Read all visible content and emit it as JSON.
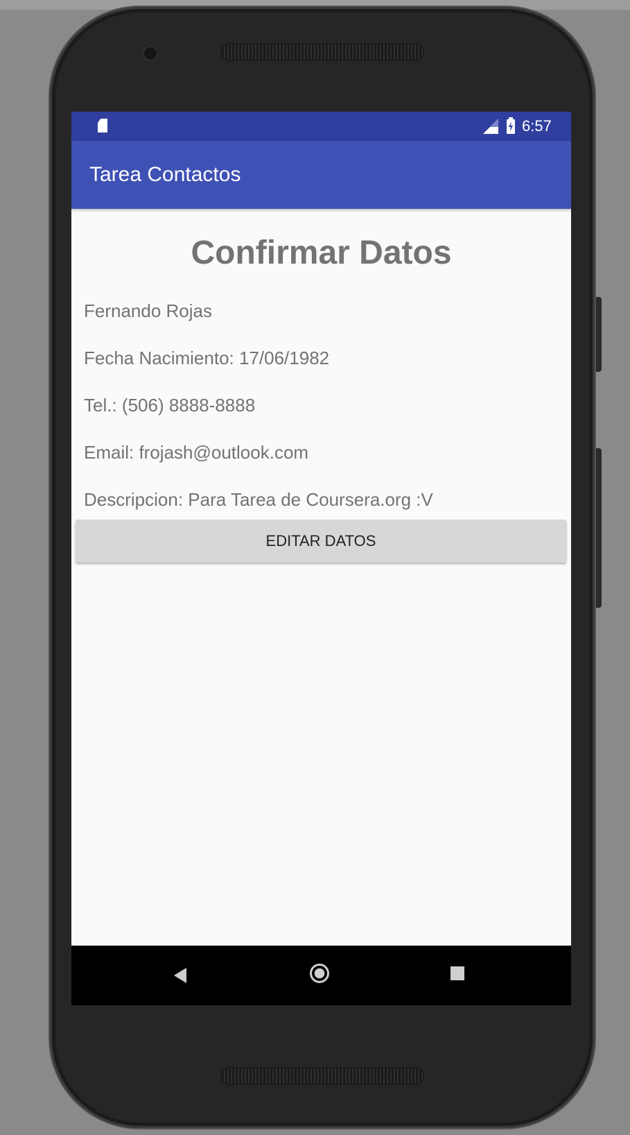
{
  "status_bar": {
    "time": "6:57",
    "icons": [
      "sd-card-icon",
      "signal-icon",
      "battery-icon"
    ]
  },
  "app_bar": {
    "title": "Tarea Contactos"
  },
  "content": {
    "heading": "Confirmar Datos",
    "name": "Fernando Rojas",
    "birth_date": "Fecha Nacimiento: 17/06/1982",
    "phone": "Tel.: (506) 8888-8888",
    "email": "Email: frojash@outlook.com",
    "description": "Descripcion: Para Tarea de Coursera.org :V",
    "edit_button_label": "EDITAR DATOS"
  },
  "nav_bar": {
    "icons": [
      "back-icon",
      "home-icon",
      "recent-apps-icon"
    ]
  },
  "colors": {
    "status_bar": "#303f9f",
    "app_bar": "#3f51b5",
    "text": "#737373",
    "button": "#d6d7d7"
  }
}
